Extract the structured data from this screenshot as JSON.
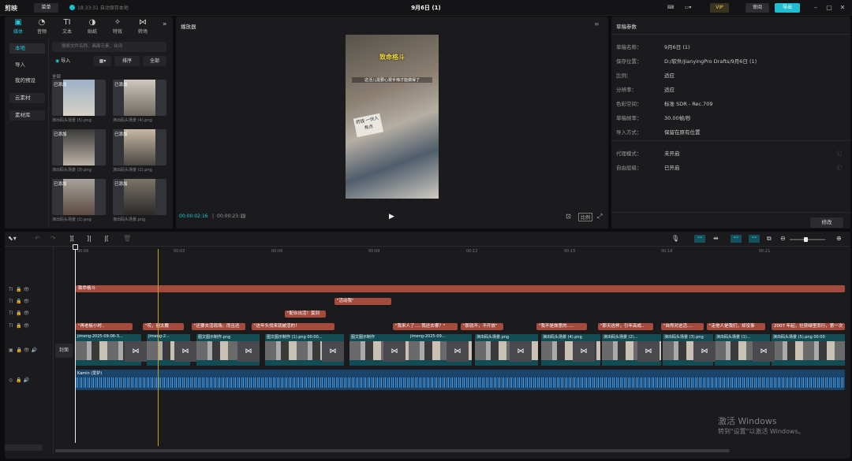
{
  "titlebar": {
    "app": "剪映",
    "menu": "菜单",
    "save_status": "18:33:31 自动保存本地",
    "title": "9月6日 (1)",
    "vip": "VIP",
    "review": "审阅",
    "export": "导出"
  },
  "media": {
    "tools": [
      {
        "label": "媒体",
        "icon": "▣"
      },
      {
        "label": "音频",
        "icon": "◔"
      },
      {
        "label": "文本",
        "icon": "TI"
      },
      {
        "label": "贴纸",
        "icon": "◑"
      },
      {
        "label": "特效",
        "icon": "✧"
      },
      {
        "label": "转场",
        "icon": "⋈"
      }
    ],
    "more": "»",
    "side": [
      "本地",
      "导入",
      "我的预设",
      "云素材",
      "素材库"
    ],
    "search_placeholder": "搜索文件名称、画面元素、台词",
    "import": "导入",
    "sort": "排序",
    "filter_all": "全部",
    "group": "全部",
    "items": [
      {
        "tag": "已添加",
        "cap": "演出码头场景 (5).png"
      },
      {
        "tag": "已添加",
        "cap": "演出码头场景 (4).png"
      },
      {
        "tag": "已添加",
        "cap": "演出码头场景 (3).png"
      },
      {
        "tag": "已添加",
        "cap": "演出码头场景 (2).png"
      },
      {
        "tag": "已添加",
        "cap": "演出码头场景 (1).png"
      },
      {
        "tag": "已添加",
        "cap": "演出码头场景.png"
      }
    ]
  },
  "player": {
    "title": "播放器",
    "caption1": "致命格斗",
    "caption2": "这活儿需要心狠手辣才能做得了",
    "note": "药钱 一伙人有点",
    "time_current": "00:00:02:16",
    "time_total": "00:00:23:19",
    "ratio": "比例"
  },
  "props": {
    "title": "草稿参数",
    "rows": [
      {
        "k": "草稿名称：",
        "v": "9月6日 (1)"
      },
      {
        "k": "保存位置：",
        "v": "D:/软件/JianyingPro Drafts/9月6日 (1)"
      },
      {
        "k": "比例：",
        "v": "适应"
      },
      {
        "k": "分辨率：",
        "v": "适应"
      },
      {
        "k": "色彩空间：",
        "v": "标准 SDR - Rec.709"
      },
      {
        "k": "草稿帧率：",
        "v": "30.00帧/秒"
      },
      {
        "k": "导入方式：",
        "v": "保留在原有位置"
      },
      {
        "k": "代理模式：",
        "v": "未开启"
      },
      {
        "k": "自由层级：",
        "v": "已开启"
      }
    ],
    "modify": "修改"
  },
  "timeline": {
    "ruler": [
      "00:00",
      "00:03",
      "00:06",
      "00:09",
      "00:12",
      "00:15",
      "00:18",
      "00:21"
    ],
    "cover": "封面",
    "title_clip": "致命格斗",
    "text_row2": "\"活动我\"",
    "text_row3": "\"配合出活！莫到",
    "text_row4": [
      "\"再老板小时..",
      "\"哎，别太戴",
      "\"还要去活现场。而且还",
      "\"这年头找来就被活的！",
      "\"我来人了.... 我还去哪？\"",
      "\"那就不，不开放\"",
      "\"我不是故意的.....",
      "\"那天这样，引年高成..",
      "\"自然对这活....",
      "\"走他人是我们，却没事",
      "2007 年起，社获绿里而行，第一次"
    ],
    "video_clips": [
      "jimeng-2025-09-06-3...",
      "jimeng-2...",
      "图文图示制作.png",
      "图文图示制作 (1).png  00:00...",
      "图文图示制作",
      "jimeng-2025-09...",
      "演出码头场景.png",
      "演出码头场景 (4).png",
      "演出码头场景 (2)...",
      "演出码头场景 (3).png",
      "演出码头场景 (1)...",
      "演出码头场景 (5).png 00:00"
    ],
    "audio": "Kamin (爱护)"
  },
  "watermark": {
    "line1": "激活 Windows",
    "line2": "转到\"设置\"以激活 Windows。"
  }
}
